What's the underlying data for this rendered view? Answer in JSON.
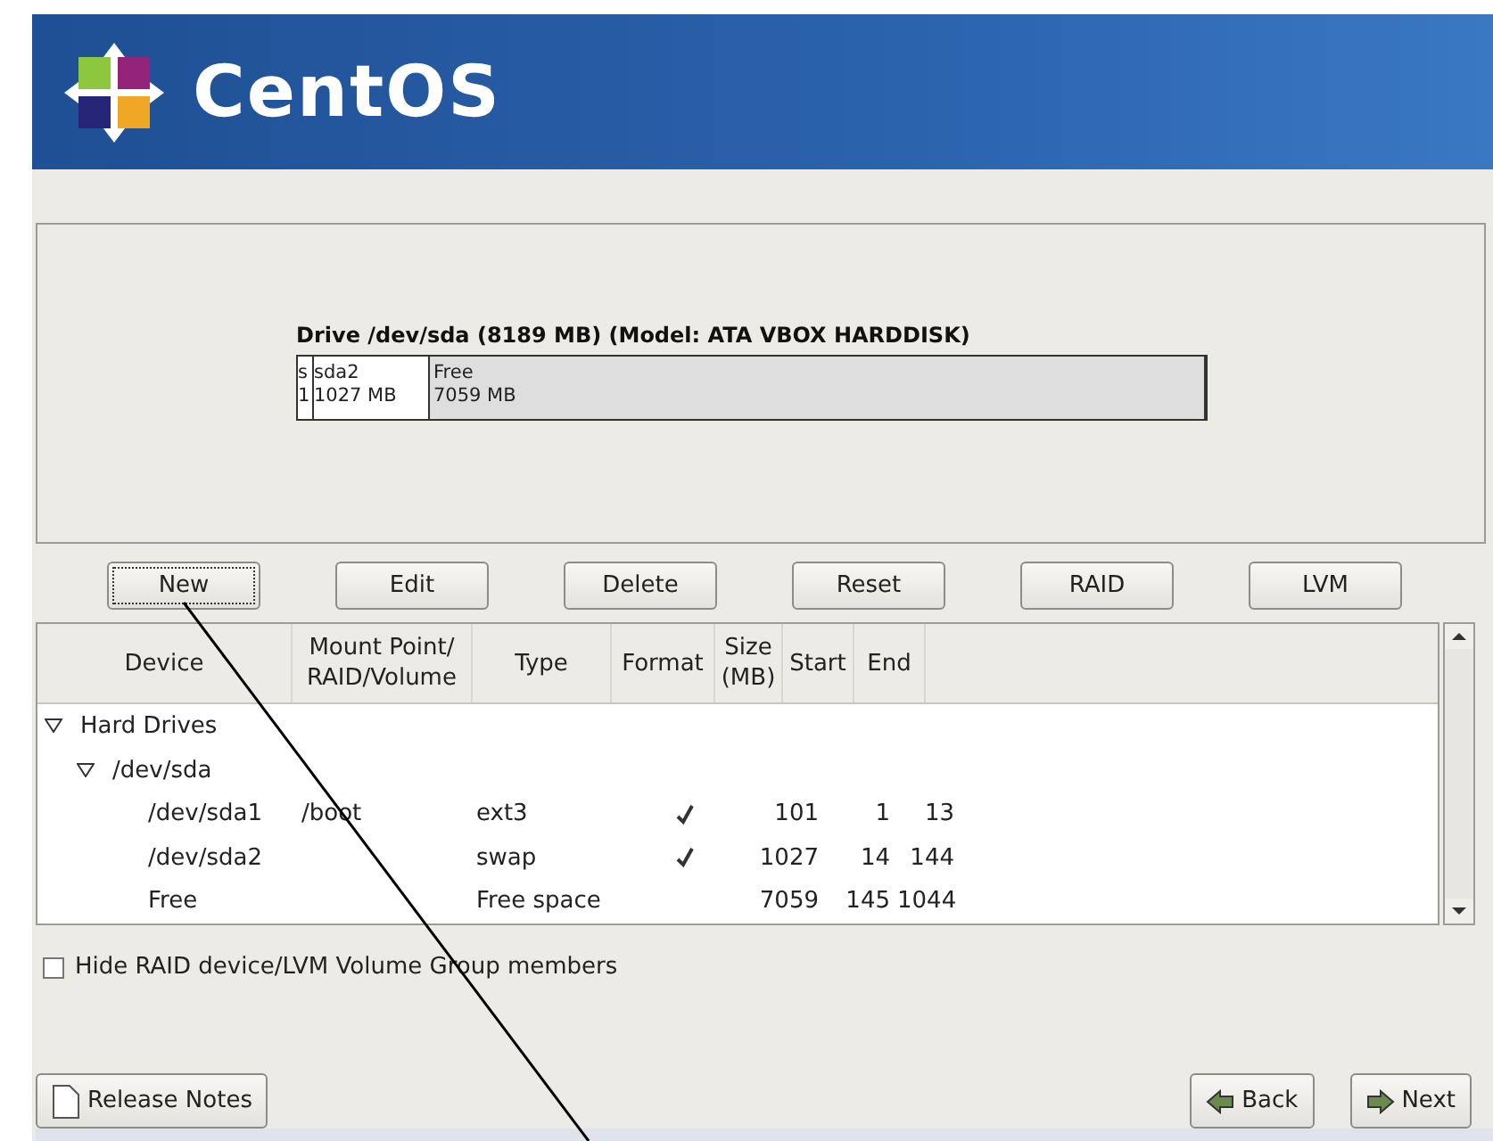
{
  "header": {
    "brand": "CentOS"
  },
  "drive": {
    "title": "Drive /dev/sda (8189 MB) (Model: ATA VBOX HARDDISK)",
    "segments": [
      {
        "kind": "sliver",
        "name": "s",
        "size": "1"
      },
      {
        "kind": "used",
        "name": "sda2",
        "size": "1027 MB"
      },
      {
        "kind": "free",
        "name": "Free",
        "size": "7059 MB"
      }
    ]
  },
  "actions": [
    {
      "label": "New",
      "focused": true
    },
    {
      "label": "Edit",
      "focused": false
    },
    {
      "label": "Delete",
      "focused": false
    },
    {
      "label": "Reset",
      "focused": false
    },
    {
      "label": "RAID",
      "focused": false
    },
    {
      "label": "LVM",
      "focused": false
    }
  ],
  "table": {
    "columns": [
      "Device",
      "Mount Point/\nRAID/Volume",
      "Type",
      "Format",
      "Size\n(MB)",
      "Start",
      "End"
    ],
    "rows": [
      {
        "label": "Hard Drives",
        "expanded": true,
        "children": [
          {
            "label": "/dev/sda",
            "expanded": true,
            "children": [
              {
                "device": "/dev/sda1",
                "mount": "/boot",
                "type": "ext3",
                "format": true,
                "size": "101",
                "start": "1",
                "end": "13"
              },
              {
                "device": "/dev/sda2",
                "type": "swap",
                "format": true,
                "size": "1027",
                "start": "14",
                "end": "144"
              },
              {
                "device": "Free",
                "type": "Free space",
                "format": false,
                "size": "7059",
                "start": "145",
                "end": "1044"
              }
            ]
          }
        ]
      }
    ]
  },
  "hide_members": {
    "label": "Hide RAID device/LVM Volume Group members",
    "checked": false
  },
  "footer": {
    "release_notes": "Release Notes",
    "back": "Back",
    "next": "Next"
  }
}
